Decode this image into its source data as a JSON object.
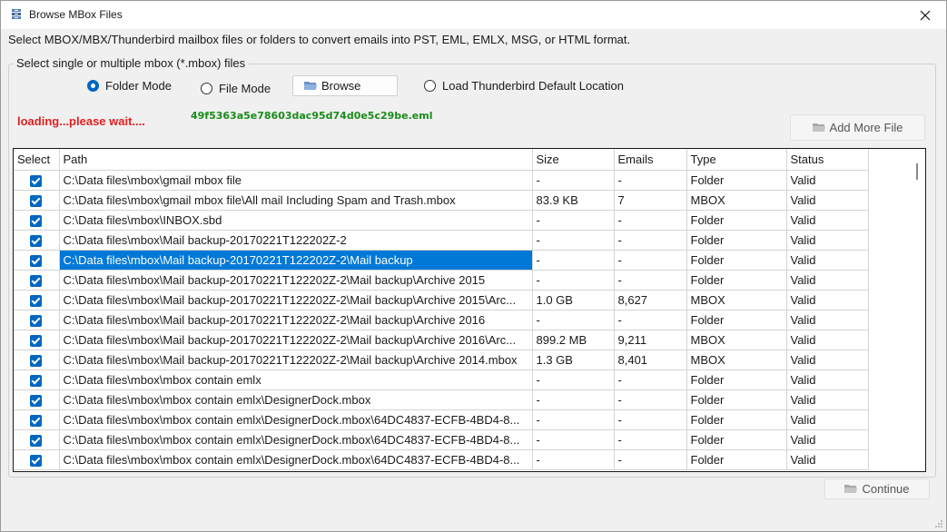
{
  "window": {
    "title": "Browse MBox Files",
    "close_glyph": "✕"
  },
  "instruction": "Select MBOX/MBX/Thunderbird mailbox files or folders to convert emails into PST, EML, EMLX, MSG, or HTML format.",
  "group": {
    "legend": "Select single or multiple mbox (*.mbox) files",
    "folder_mode_label": "Folder Mode",
    "file_mode_label": "File Mode",
    "browse_label": "Browse",
    "thunderbird_label": "Load Thunderbird Default Location",
    "selected_mode": "Folder Mode"
  },
  "status": {
    "loading": "loading...please wait....",
    "current_file": "49f5363a5e78603dac95d74d0e5c29be.eml"
  },
  "buttons": {
    "add_more": "Add More File",
    "continue": "Continue"
  },
  "icons": {
    "title": "mailbox-stack-icon",
    "folder": "folder-icon",
    "close": "close-icon"
  },
  "colors": {
    "accent": "#0067c0",
    "selection": "#0078d7",
    "loading": "#e02020",
    "current_file": "#1a8c1a"
  },
  "table": {
    "columns": [
      "Select",
      "Path",
      "Size",
      "Emails",
      "Type",
      "Status"
    ],
    "selected_row": 4,
    "rows": [
      {
        "checked": true,
        "path": "C:\\Data files\\mbox\\gmail mbox file",
        "size": "-",
        "emails": "-",
        "type": "Folder",
        "status": "Valid"
      },
      {
        "checked": true,
        "path": "C:\\Data files\\mbox\\gmail mbox file\\All mail Including Spam and Trash.mbox",
        "size": "83.9 KB",
        "emails": "7",
        "type": "MBOX",
        "status": "Valid"
      },
      {
        "checked": true,
        "path": "C:\\Data files\\mbox\\INBOX.sbd",
        "size": "-",
        "emails": "-",
        "type": "Folder",
        "status": "Valid"
      },
      {
        "checked": true,
        "path": "C:\\Data files\\mbox\\Mail backup-20170221T122202Z-2",
        "size": "-",
        "emails": "-",
        "type": "Folder",
        "status": "Valid"
      },
      {
        "checked": true,
        "path": "C:\\Data files\\mbox\\Mail backup-20170221T122202Z-2\\Mail backup",
        "size": "-",
        "emails": "-",
        "type": "Folder",
        "status": "Valid"
      },
      {
        "checked": true,
        "path": "C:\\Data files\\mbox\\Mail backup-20170221T122202Z-2\\Mail backup\\Archive 2015",
        "size": "-",
        "emails": "-",
        "type": "Folder",
        "status": "Valid"
      },
      {
        "checked": true,
        "path": "C:\\Data files\\mbox\\Mail backup-20170221T122202Z-2\\Mail backup\\Archive 2015\\Arc...",
        "size": "1.0 GB",
        "emails": "8,627",
        "type": "MBOX",
        "status": "Valid"
      },
      {
        "checked": true,
        "path": "C:\\Data files\\mbox\\Mail backup-20170221T122202Z-2\\Mail backup\\Archive 2016",
        "size": "-",
        "emails": "-",
        "type": "Folder",
        "status": "Valid"
      },
      {
        "checked": true,
        "path": "C:\\Data files\\mbox\\Mail backup-20170221T122202Z-2\\Mail backup\\Archive 2016\\Arc...",
        "size": "899.2 MB",
        "emails": "9,211",
        "type": "MBOX",
        "status": "Valid"
      },
      {
        "checked": true,
        "path": "C:\\Data files\\mbox\\Mail backup-20170221T122202Z-2\\Mail backup\\Archive 2014.mbox",
        "size": "1.3 GB",
        "emails": "8,401",
        "type": "MBOX",
        "status": "Valid"
      },
      {
        "checked": true,
        "path": "C:\\Data files\\mbox\\mbox contain emlx",
        "size": "-",
        "emails": "-",
        "type": "Folder",
        "status": "Valid"
      },
      {
        "checked": true,
        "path": "C:\\Data files\\mbox\\mbox contain emlx\\DesignerDock.mbox",
        "size": "-",
        "emails": "-",
        "type": "Folder",
        "status": "Valid"
      },
      {
        "checked": true,
        "path": "C:\\Data files\\mbox\\mbox contain emlx\\DesignerDock.mbox\\64DC4837-ECFB-4BD4-8...",
        "size": "-",
        "emails": "-",
        "type": "Folder",
        "status": "Valid"
      },
      {
        "checked": true,
        "path": "C:\\Data files\\mbox\\mbox contain emlx\\DesignerDock.mbox\\64DC4837-ECFB-4BD4-8...",
        "size": "-",
        "emails": "-",
        "type": "Folder",
        "status": "Valid"
      },
      {
        "checked": true,
        "path": "C:\\Data files\\mbox\\mbox contain emlx\\DesignerDock.mbox\\64DC4837-ECFB-4BD4-8...",
        "size": "-",
        "emails": "-",
        "type": "Folder",
        "status": "Valid"
      }
    ]
  }
}
